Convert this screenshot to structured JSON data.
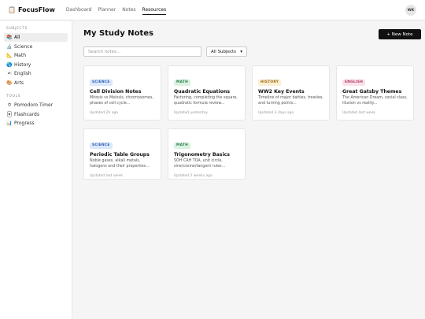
{
  "app": {
    "name": "FocusFlow",
    "logo_icon": "clipboard-icon",
    "nav": [
      "Dashboard",
      "Planner",
      "Notes",
      "Resources"
    ],
    "active_nav": "Resources",
    "user_initials": "WK"
  },
  "sidebar": {
    "subjects_heading": "SUBJECTS",
    "subjects": [
      {
        "label": "All",
        "icon": "books-icon",
        "active": true
      },
      {
        "label": "Science",
        "icon": "microscope-icon"
      },
      {
        "label": "Math",
        "icon": "ruler-icon"
      },
      {
        "label": "History",
        "icon": "globe-icon"
      },
      {
        "label": "English",
        "icon": "pencil-icon"
      },
      {
        "label": "Arts",
        "icon": "palette-icon"
      }
    ],
    "tools_heading": "TOOLS",
    "tools": [
      {
        "label": "Pomodoro Timer",
        "icon": "timer-icon"
      },
      {
        "label": "Flashcards",
        "icon": "flashcards-icon"
      },
      {
        "label": "Progress",
        "icon": "chart-icon"
      }
    ]
  },
  "main": {
    "title": "My Study Notes",
    "new_button": "+ New Note",
    "search_placeholder": "Search notes...",
    "filter_value": "All Subjects",
    "notes": [
      {
        "tag": "SCIENCE",
        "tag_bg": "#dbe7fb",
        "tag_color": "#2f5fb3",
        "title": "Cell Division Notes",
        "desc": "Mitosis vs Meiosis, chromosomes, phases of cell cycle...",
        "updated": "Updated 2h ago"
      },
      {
        "tag": "MATH",
        "tag_bg": "#d9f2e1",
        "tag_color": "#2e7d4f",
        "title": "Quadratic Equations",
        "desc": "Factoring, completing the square, quadratic formula review...",
        "updated": "Updated yesterday"
      },
      {
        "tag": "HISTORY",
        "tag_bg": "#fcefd2",
        "tag_color": "#9a6a12",
        "title": "WW2 Key Events",
        "desc": "Timeline of major battles, treaties, and turning points...",
        "updated": "Updated 3 days ago"
      },
      {
        "tag": "ENGLISH",
        "tag_bg": "#fbe1ea",
        "tag_color": "#b33a64",
        "title": "Great Gatsby Themes",
        "desc": "The American Dream, social class, illusion vs reality...",
        "updated": "Updated last week"
      },
      {
        "tag": "SCIENCE",
        "tag_bg": "#dbe7fb",
        "tag_color": "#2f5fb3",
        "title": "Periodic Table Groups",
        "desc": "Noble gases, alkali metals, halogens and their properties...",
        "updated": "Updated last week"
      },
      {
        "tag": "MATH",
        "tag_bg": "#d9f2e1",
        "tag_color": "#2e7d4f",
        "title": "Trigonometry Basics",
        "desc": "SOH CAH TOA, unit circle, sine/cosine/tangent rules...",
        "updated": "Updated 2 weeks ago"
      }
    ]
  }
}
